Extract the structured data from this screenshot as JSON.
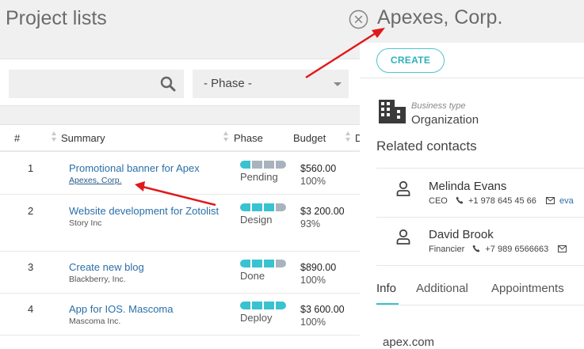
{
  "left": {
    "title": "Project lists",
    "search": {
      "placeholder": ""
    },
    "phase_filter": {
      "value": "- Phase -"
    },
    "table": {
      "headers": [
        "#",
        "Summary",
        "Phase",
        "Budget",
        "D"
      ],
      "rows": [
        {
          "num": "1",
          "summary": "Promotional banner for Apex",
          "company": "Apexes, Corp.",
          "phase": "Pending",
          "phase_level": 1,
          "budget": "$560.00",
          "pct": "100%"
        },
        {
          "num": "2",
          "summary": "Website development for Zotolist",
          "company": "Story Inc",
          "phase": "Design",
          "phase_level": 3,
          "budget": "$3 200.00",
          "pct": "93%"
        },
        {
          "num": "3",
          "summary": "Create new blog",
          "company": "Blackberry, Inc.",
          "phase": "Done",
          "phase_level": 3,
          "budget": "$890.00",
          "pct": "100%"
        },
        {
          "num": "4",
          "summary": "App for IOS. Mascoma",
          "company": "Mascoma Inc.",
          "phase": "Deploy",
          "phase_level": 4,
          "budget": "$3 600.00",
          "pct": "100%"
        }
      ]
    }
  },
  "right": {
    "title": "Apexes, Corp.",
    "create_label": "CREATE",
    "business_type_label": "Business type",
    "business_type_value": "Organization",
    "related_title": "Related contacts",
    "contacts": [
      {
        "name": "Melinda Evans",
        "role": "CEO",
        "phone": "+1 978 645 45 66",
        "email": "eva"
      },
      {
        "name": "David Brook",
        "role": "Financier",
        "phone": "+7 989 6566663",
        "email": ""
      }
    ],
    "tabs": [
      "Info",
      "Additional",
      "Appointments"
    ],
    "website": "apex.com"
  },
  "colors": {
    "accent": "#39c2cf",
    "link": "#2a6fa8",
    "arrow": "#e0191b"
  }
}
